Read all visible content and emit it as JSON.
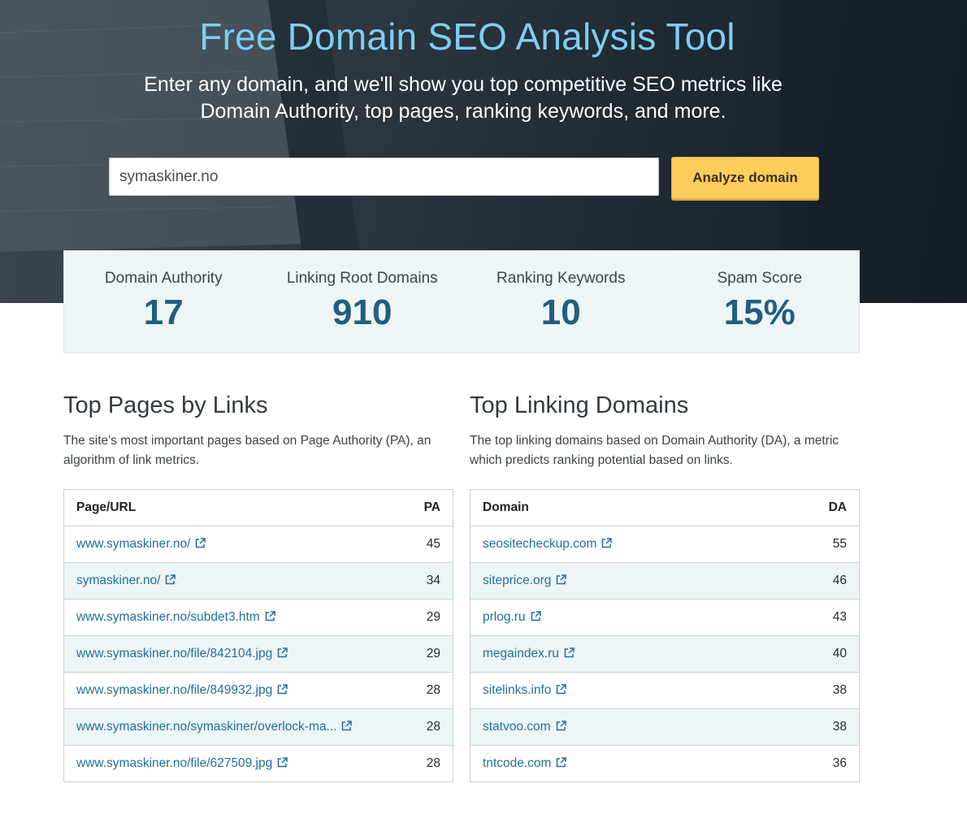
{
  "hero": {
    "title": "Free Domain SEO Analysis Tool",
    "subtitle": "Enter any domain, and we'll show you top competitive SEO metrics like Domain Authority, top pages, ranking keywords, and more.",
    "domain_value": "symaskiner.no",
    "analyze_label": "Analyze domain"
  },
  "metrics": [
    {
      "label": "Domain Authority",
      "value": "17"
    },
    {
      "label": "Linking Root Domains",
      "value": "910"
    },
    {
      "label": "Ranking Keywords",
      "value": "10"
    },
    {
      "label": "Spam Score",
      "value": "15%"
    }
  ],
  "top_pages": {
    "title": "Top Pages by Links",
    "description": "The site's most important pages based on Page Authority (PA), an algorithm of link metrics.",
    "col_url": "Page/URL",
    "col_pa": "PA",
    "rows": [
      {
        "url": "www.symaskiner.no/",
        "pa": "45"
      },
      {
        "url": "symaskiner.no/",
        "pa": "34"
      },
      {
        "url": "www.symaskiner.no/subdet3.htm",
        "pa": "29"
      },
      {
        "url": "www.symaskiner.no/file/842104.jpg",
        "pa": "29"
      },
      {
        "url": "www.symaskiner.no/file/849932.jpg",
        "pa": "28"
      },
      {
        "url": "www.symaskiner.no/symaskiner/overlock-ma...",
        "pa": "28"
      },
      {
        "url": "www.symaskiner.no/file/627509.jpg",
        "pa": "28"
      }
    ]
  },
  "top_domains": {
    "title": "Top Linking Domains",
    "description": "The top linking domains based on Domain Authority (DA), a metric which predicts ranking potential based on links.",
    "col_domain": "Domain",
    "col_da": "DA",
    "rows": [
      {
        "domain": "seositecheckup.com",
        "da": "55"
      },
      {
        "domain": "siteprice.org",
        "da": "46"
      },
      {
        "domain": "prlog.ru",
        "da": "43"
      },
      {
        "domain": "megaindex.ru",
        "da": "40"
      },
      {
        "domain": "sitelinks.info",
        "da": "38"
      },
      {
        "domain": "statvoo.com",
        "da": "38"
      },
      {
        "domain": "tntcode.com",
        "da": "36"
      }
    ]
  }
}
